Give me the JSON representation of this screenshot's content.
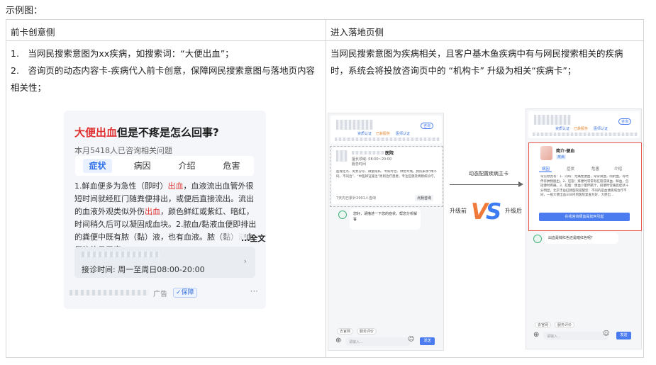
{
  "caption": "示例图：",
  "table": {
    "header_left": "前卡创意侧",
    "header_right": "进入落地页侧",
    "left_items": [
      "1.　当网民搜索意图为xx疾病，如搜索词：“大便出血”；",
      "2.　咨询页的动态内容卡-疾病代入前卡创意，保障网民搜索意图与落地页内容相关性；"
    ],
    "right_paragraph": "当网民搜索意图为疾病相关，且客户基木鱼疾病中有与网民搜索相关的疾病时，系统会将投放咨询页中的 “机构卡” 升级为相关“疾病卡”；"
  },
  "card": {
    "title_red": "大便出血",
    "title_rest": "但是不疼是怎么回事?",
    "subtitle": "本月5418人已咨询相关问题",
    "tabs": [
      "症状",
      "病因",
      "介绍",
      "危害"
    ],
    "active_tab": "症状",
    "body_1": "1.鲜血便多为急性（即时）",
    "body_red_1": "出血",
    "body_2": "，血液流出血管外很短时间就经肛门随粪便排出，或便后直接流出。流出的血液外观类似外伤",
    "body_red_2": "出血",
    "body_3": "，颜色鲜红或紫红、暗红，时间稍久后可以凝固成血块。2.脓血/黏液血便即排出的粪便中既有脓（黏）液，也有血液。脓（黏）液血便往往见于直",
    "more": "...全文",
    "hours": "接诊时间: 周一至周日08:00-20:00",
    "ad_label": "广告",
    "ad_badge": "✓保障",
    "menu": "···"
  },
  "illustration": {
    "arrow_label": "动态配置疾病主卡",
    "before_label": "升级前",
    "after_label": "升级后",
    "vs_v": "V",
    "vs_s": "S",
    "before": {
      "consult_btn": "咨询",
      "badge_1": "资质认证",
      "badge_2": "已获服务",
      "badge_3": "医师认证",
      "name": "医院",
      "info_line_1": "擅长领域: 08:00~20:00",
      "info_line_2": "服务时间",
      "desc": "医保定点、男女分诊、微量隐私、专病专治、绿色专线。我院秉承“精不同、不同治”、“中医辨证施治”原则治疗患者，专注肛肠及胃肠病诊疗。",
      "stat": "7天内已累计2001人咨询",
      "consult_now": "点我咨询",
      "bot_msg": "您好，请描述一下您的症状，帮您分析解答",
      "quick_1": "去官网",
      "quick_2": "服务评价",
      "input_ph": "请输入...",
      "send": "发送"
    },
    "after": {
      "consult_btn": "咨询",
      "badge_1": "资质认证",
      "badge_2": "已获服务",
      "badge_3": "医师认证",
      "disease": "简介·便血",
      "tag": "疾病",
      "tabs": [
        "病因",
        "症状",
        "危害",
        "介绍"
      ],
      "desc": "常见原因有：1、内痔：无痛性便血，常常滴血，喷射血，有时伴有肿物脱出。2、肛裂：排便时常常有肛裂或滴血、鲜血，包括便时疼痛。3、肛瘘：便血少量伴脓汁，排便时常痛且症状十分明显。北京丰益肛肠医院提醒您：不同的是血便疾病治疗不同，一般大便出血三日内到医院复查为好，大便出…",
      "cta": "在线咨询便血是如何引起",
      "question": "出血是鲜红色还是暗红色呢？",
      "quick_1": "去官网",
      "quick_2": "服务评价",
      "input_ph": "请输入...",
      "send": "发送"
    }
  },
  "colors": {
    "accent_red": "#e03131",
    "accent_blue": "#2b6de8",
    "vs_orange": "#f07a3a",
    "vs_blue": "#3d7bf2",
    "highlight_border": "#e8534b"
  }
}
